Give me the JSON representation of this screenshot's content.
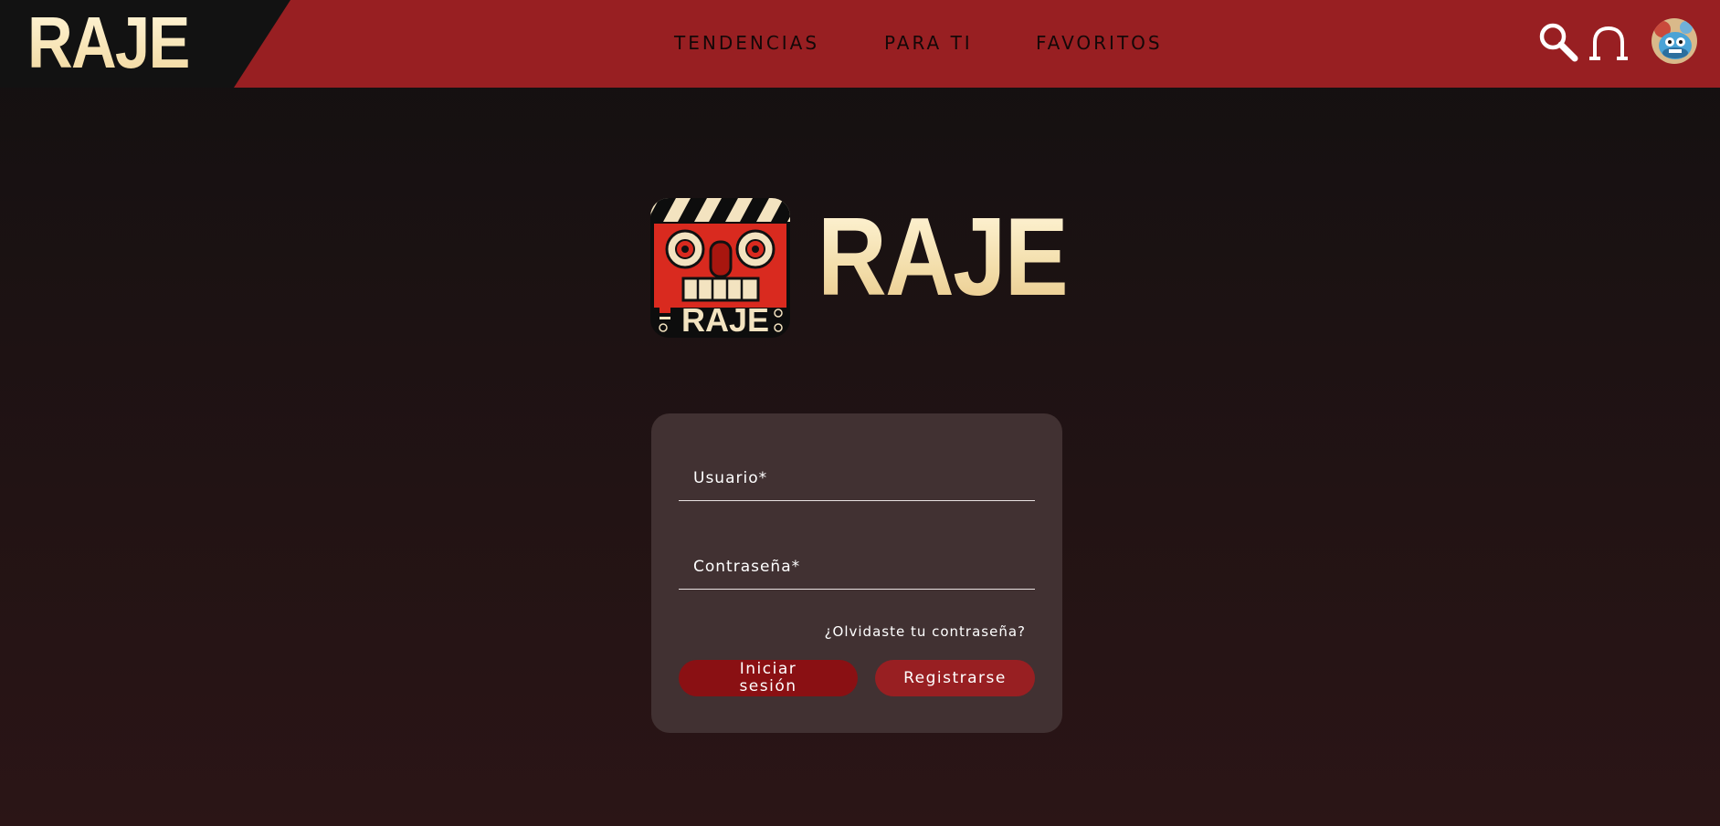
{
  "header": {
    "logo_text": "RAJE",
    "nav": [
      "TENDENCIAS",
      "PARA TI",
      "FAVORITOS"
    ],
    "icons": {
      "search": "search-icon",
      "notifications": "bell-icon",
      "avatar": "user-avatar"
    }
  },
  "hero": {
    "app_icon_text": "RAJE",
    "logo_text": "RAJE"
  },
  "login": {
    "username_label": "Usuario*",
    "username_value": "",
    "password_label": "Contraseña*",
    "password_value": "",
    "forgot_link": "¿Olvidaste tu contraseña?",
    "login_button": "Iniciar sesión",
    "register_button": "Registrarse"
  },
  "colors": {
    "header_red": "#981f22",
    "header_dark": "#121212",
    "logo_cream": "#f7e3b3",
    "card_bg": "#413132",
    "login_button": "#8a1013",
    "register_button": "#981f22"
  }
}
